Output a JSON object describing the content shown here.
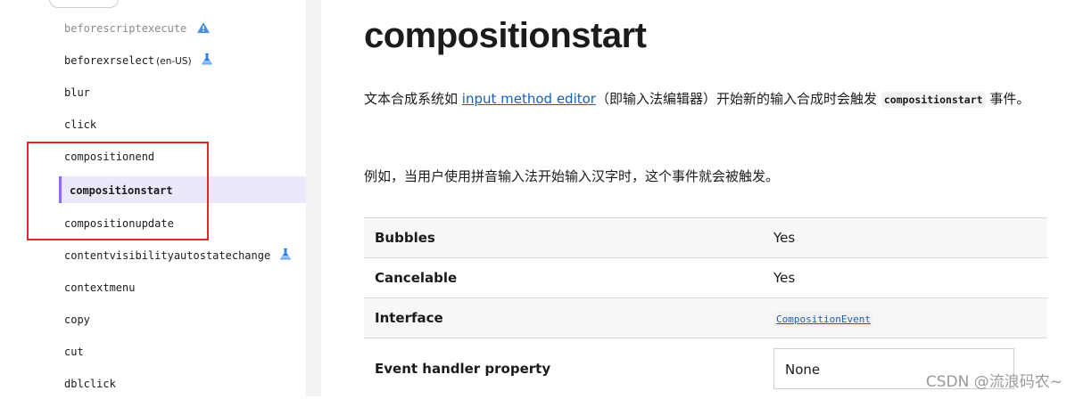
{
  "sidebar": {
    "items": [
      {
        "label": "beforescriptexecute",
        "icon": "warning-icon",
        "dim": true
      },
      {
        "label": "beforexrselect",
        "locale": "(en-US)",
        "icon": "experimental-flask-icon"
      },
      {
        "label": "blur"
      },
      {
        "label": "click"
      },
      {
        "label": "compositionend"
      },
      {
        "label": "compositionstart",
        "active": true
      },
      {
        "label": "compositionupdate"
      },
      {
        "label": "contentvisibilityautostatechange",
        "icon": "experimental-flask-icon"
      },
      {
        "label": "contextmenu"
      },
      {
        "label": "copy"
      },
      {
        "label": "cut"
      },
      {
        "label": "dblclick"
      }
    ]
  },
  "main": {
    "title": "compositionstart",
    "para1_before": "文本合成系统如 ",
    "para1_link": "input method editor",
    "para1_mid": "（即输入法编辑器）开始新的输入合成时会触发 ",
    "para1_code": "compositionstart",
    "para1_after": " 事件。",
    "para2": "例如，当用户使用拼音输入法开始输入汉字时，这个事件就会被触发。",
    "table": {
      "bubbles_label": "Bubbles",
      "bubbles_value": "Yes",
      "cancelable_label": "Cancelable",
      "cancelable_value": "Yes",
      "interface_label": "Interface",
      "interface_value": "CompositionEvent",
      "handler_label": "Event handler property",
      "handler_value": "None"
    }
  },
  "watermark": "CSDN @流浪码农~",
  "colors": {
    "active_bg": "#ece8fb",
    "active_border": "#8b6cf0",
    "highlight_box": "#e0262a",
    "link": "#1a5fb4"
  }
}
